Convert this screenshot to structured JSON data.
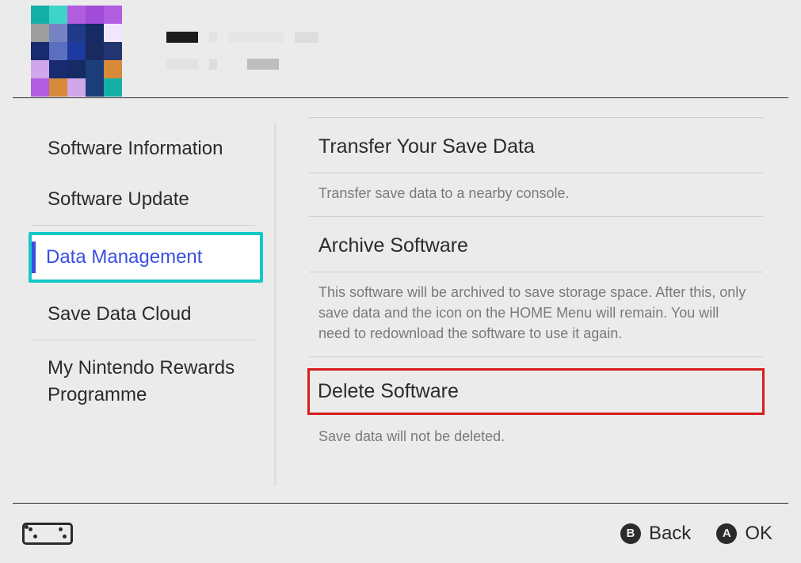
{
  "sidebar": {
    "items": [
      {
        "label": "Software Information"
      },
      {
        "label": "Software Update"
      },
      {
        "label": "Data Management",
        "selected": true
      },
      {
        "label": "Save Data Cloud"
      },
      {
        "label": "My Nintendo Rewards Programme"
      }
    ]
  },
  "content": {
    "options": [
      {
        "title": "Transfer Your Save Data",
        "desc": "Transfer save data to a nearby console."
      },
      {
        "title": "Archive Software",
        "desc": "This software will be archived to save storage space. After this, only save data and the icon on the HOME Menu will remain. You will need to redownload the software to use it again."
      },
      {
        "title": "Delete Software",
        "desc": "Save data will not be deleted.",
        "highlight": true
      }
    ]
  },
  "footer": {
    "back_glyph": "B",
    "back_label": "Back",
    "ok_glyph": "A",
    "ok_label": "OK"
  },
  "iconColors": {
    "grid": [
      "#14b0a8",
      "#3fd4c9",
      "#b15de0",
      "#a04cd8",
      "#b15de0",
      "#9e9e9e",
      "#7583c4",
      "#1f3a8a",
      "#162a63",
      "#f2e6ff",
      "#182a70",
      "#5a6fbf",
      "#1c3aa0",
      "#1b2a5e",
      "#223570",
      "#cfa7ea",
      "#182a70",
      "#162a63",
      "#1b3e7a",
      "#d68a3a",
      "#b15de0",
      "#d68a3a",
      "#cfa7ea",
      "#1b3e7a",
      "#14b0a8"
    ]
  }
}
